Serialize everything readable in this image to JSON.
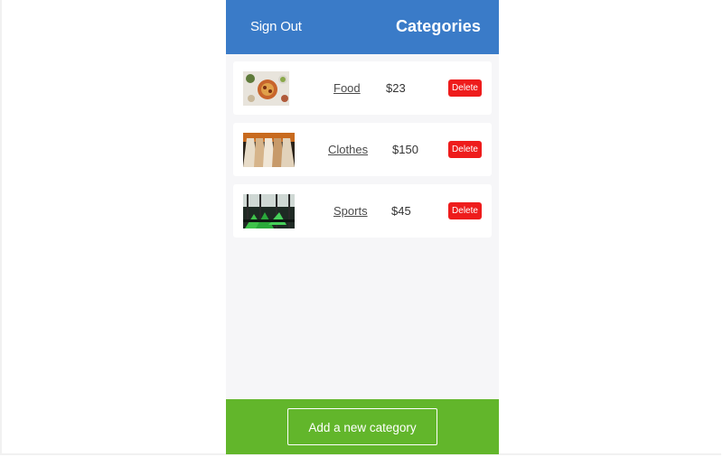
{
  "header": {
    "sign_out_label": "Sign Out",
    "title": "Categories",
    "background_color": "#3a7bc8"
  },
  "categories": [
    {
      "name": "Food",
      "price": "$23",
      "delete_label": "Delete",
      "image_icon": "food-photo"
    },
    {
      "name": "Clothes",
      "price": "$150",
      "delete_label": "Delete",
      "image_icon": "clothes-photo"
    },
    {
      "name": "Sports",
      "price": "$45",
      "delete_label": "Delete",
      "image_icon": "sports-photo"
    }
  ],
  "footer": {
    "add_label": "Add a new category",
    "background_color": "#62b62b"
  },
  "colors": {
    "delete_button": "#ee1c1c"
  }
}
